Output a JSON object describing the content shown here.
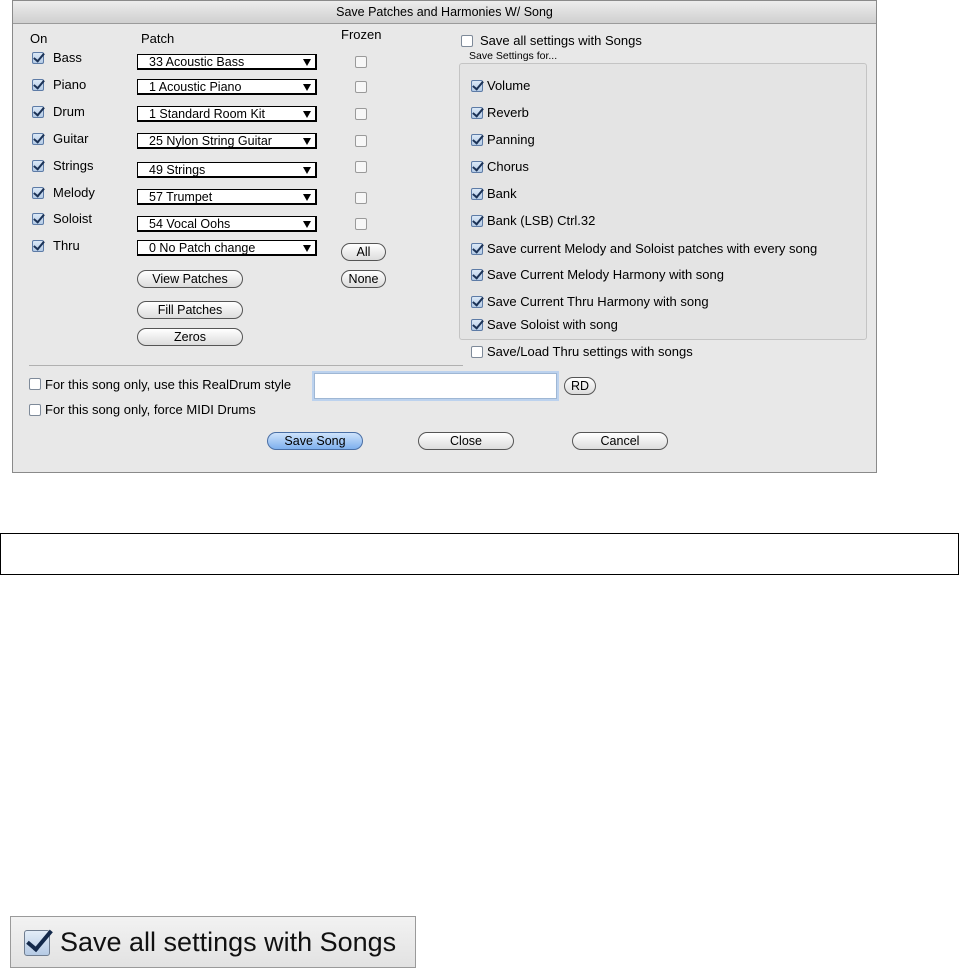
{
  "dialog": {
    "title": "Save Patches and Harmonies W/ Song",
    "headers": {
      "on": "On",
      "patch": "Patch",
      "frozen": "Frozen"
    },
    "tracks": [
      {
        "name": "Bass",
        "on": true,
        "patch": "33 Acoustic Bass",
        "frozen": false
      },
      {
        "name": "Piano",
        "on": true,
        "patch": "1 Acoustic Piano",
        "frozen": false
      },
      {
        "name": "Drum",
        "on": true,
        "patch": "1 Standard Room Kit",
        "frozen": false
      },
      {
        "name": "Guitar",
        "on": true,
        "patch": "25 Nylon String Guitar",
        "frozen": false
      },
      {
        "name": "Strings",
        "on": true,
        "patch": "49 Strings",
        "frozen": false
      },
      {
        "name": "Melody",
        "on": true,
        "patch": "57 Trumpet",
        "frozen": false
      },
      {
        "name": "Soloist",
        "on": true,
        "patch": "54 Vocal Oohs",
        "frozen": false
      },
      {
        "name": "Thru",
        "on": true,
        "patch": "0 No Patch change",
        "frozen": null
      }
    ],
    "buttons": {
      "all": "All",
      "none": "None",
      "view_patches": "View Patches",
      "fill_patches": "Fill Patches",
      "zeros": "Zeros",
      "rd": "RD",
      "save_song": "Save Song",
      "close": "Close",
      "cancel": "Cancel"
    },
    "save_all": {
      "label": "Save all settings with Songs",
      "checked": false
    },
    "save_settings_for": "Save Settings for...",
    "settings": [
      {
        "label": "Volume",
        "checked": true
      },
      {
        "label": "Reverb",
        "checked": true
      },
      {
        "label": "Panning",
        "checked": true
      },
      {
        "label": "Chorus",
        "checked": true
      },
      {
        "label": "Bank",
        "checked": true
      },
      {
        "label": "Bank (LSB) Ctrl.32",
        "checked": true
      },
      {
        "label": "Save current Melody and Soloist patches with every song",
        "checked": true
      },
      {
        "label": "Save Current Melody Harmony with song",
        "checked": true
      },
      {
        "label": "Save Current Thru Harmony with song",
        "checked": true
      },
      {
        "label": "Save Soloist with song",
        "checked": true
      }
    ],
    "save_load_thru": {
      "label": "Save/Load Thru settings with songs",
      "checked": false
    },
    "realdrum_only": {
      "label": "For this song only, use this RealDrum style",
      "checked": false
    },
    "realdrum_style_value": "",
    "force_midi": {
      "label": "For this song only, force MIDI Drums",
      "checked": false
    }
  },
  "zoom_callout": {
    "label": "Save all settings with Songs",
    "checked": true
  }
}
